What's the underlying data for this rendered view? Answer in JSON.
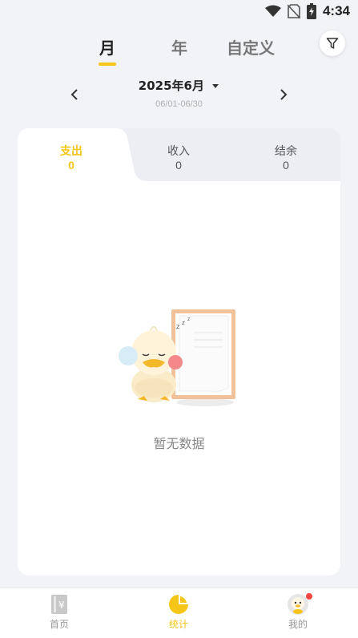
{
  "status": {
    "time": "4:34"
  },
  "period_tabs": [
    {
      "label": "月",
      "active": true
    },
    {
      "label": "年",
      "active": false
    },
    {
      "label": "自定义",
      "active": false
    }
  ],
  "date_nav": {
    "title": "2025年6月",
    "range": "06/01-06/30"
  },
  "summary_tabs": [
    {
      "label": "支出",
      "value": "0",
      "active": true
    },
    {
      "label": "收入",
      "value": "0",
      "active": false
    },
    {
      "label": "结余",
      "value": "0",
      "active": false
    }
  ],
  "empty_state": {
    "message": "暂无数据",
    "illustration": "sleeping-duck-with-paper-illustration"
  },
  "bottom_nav": [
    {
      "label": "首页",
      "icon": "home-ledger-icon",
      "active": false
    },
    {
      "label": "统计",
      "icon": "pie-chart-icon",
      "active": true
    },
    {
      "label": "我的",
      "icon": "duck-avatar-icon",
      "active": false,
      "badge": true
    }
  ],
  "colors": {
    "accent": "#f5c518",
    "background": "#f2f3f7",
    "badge": "#ff4444"
  }
}
